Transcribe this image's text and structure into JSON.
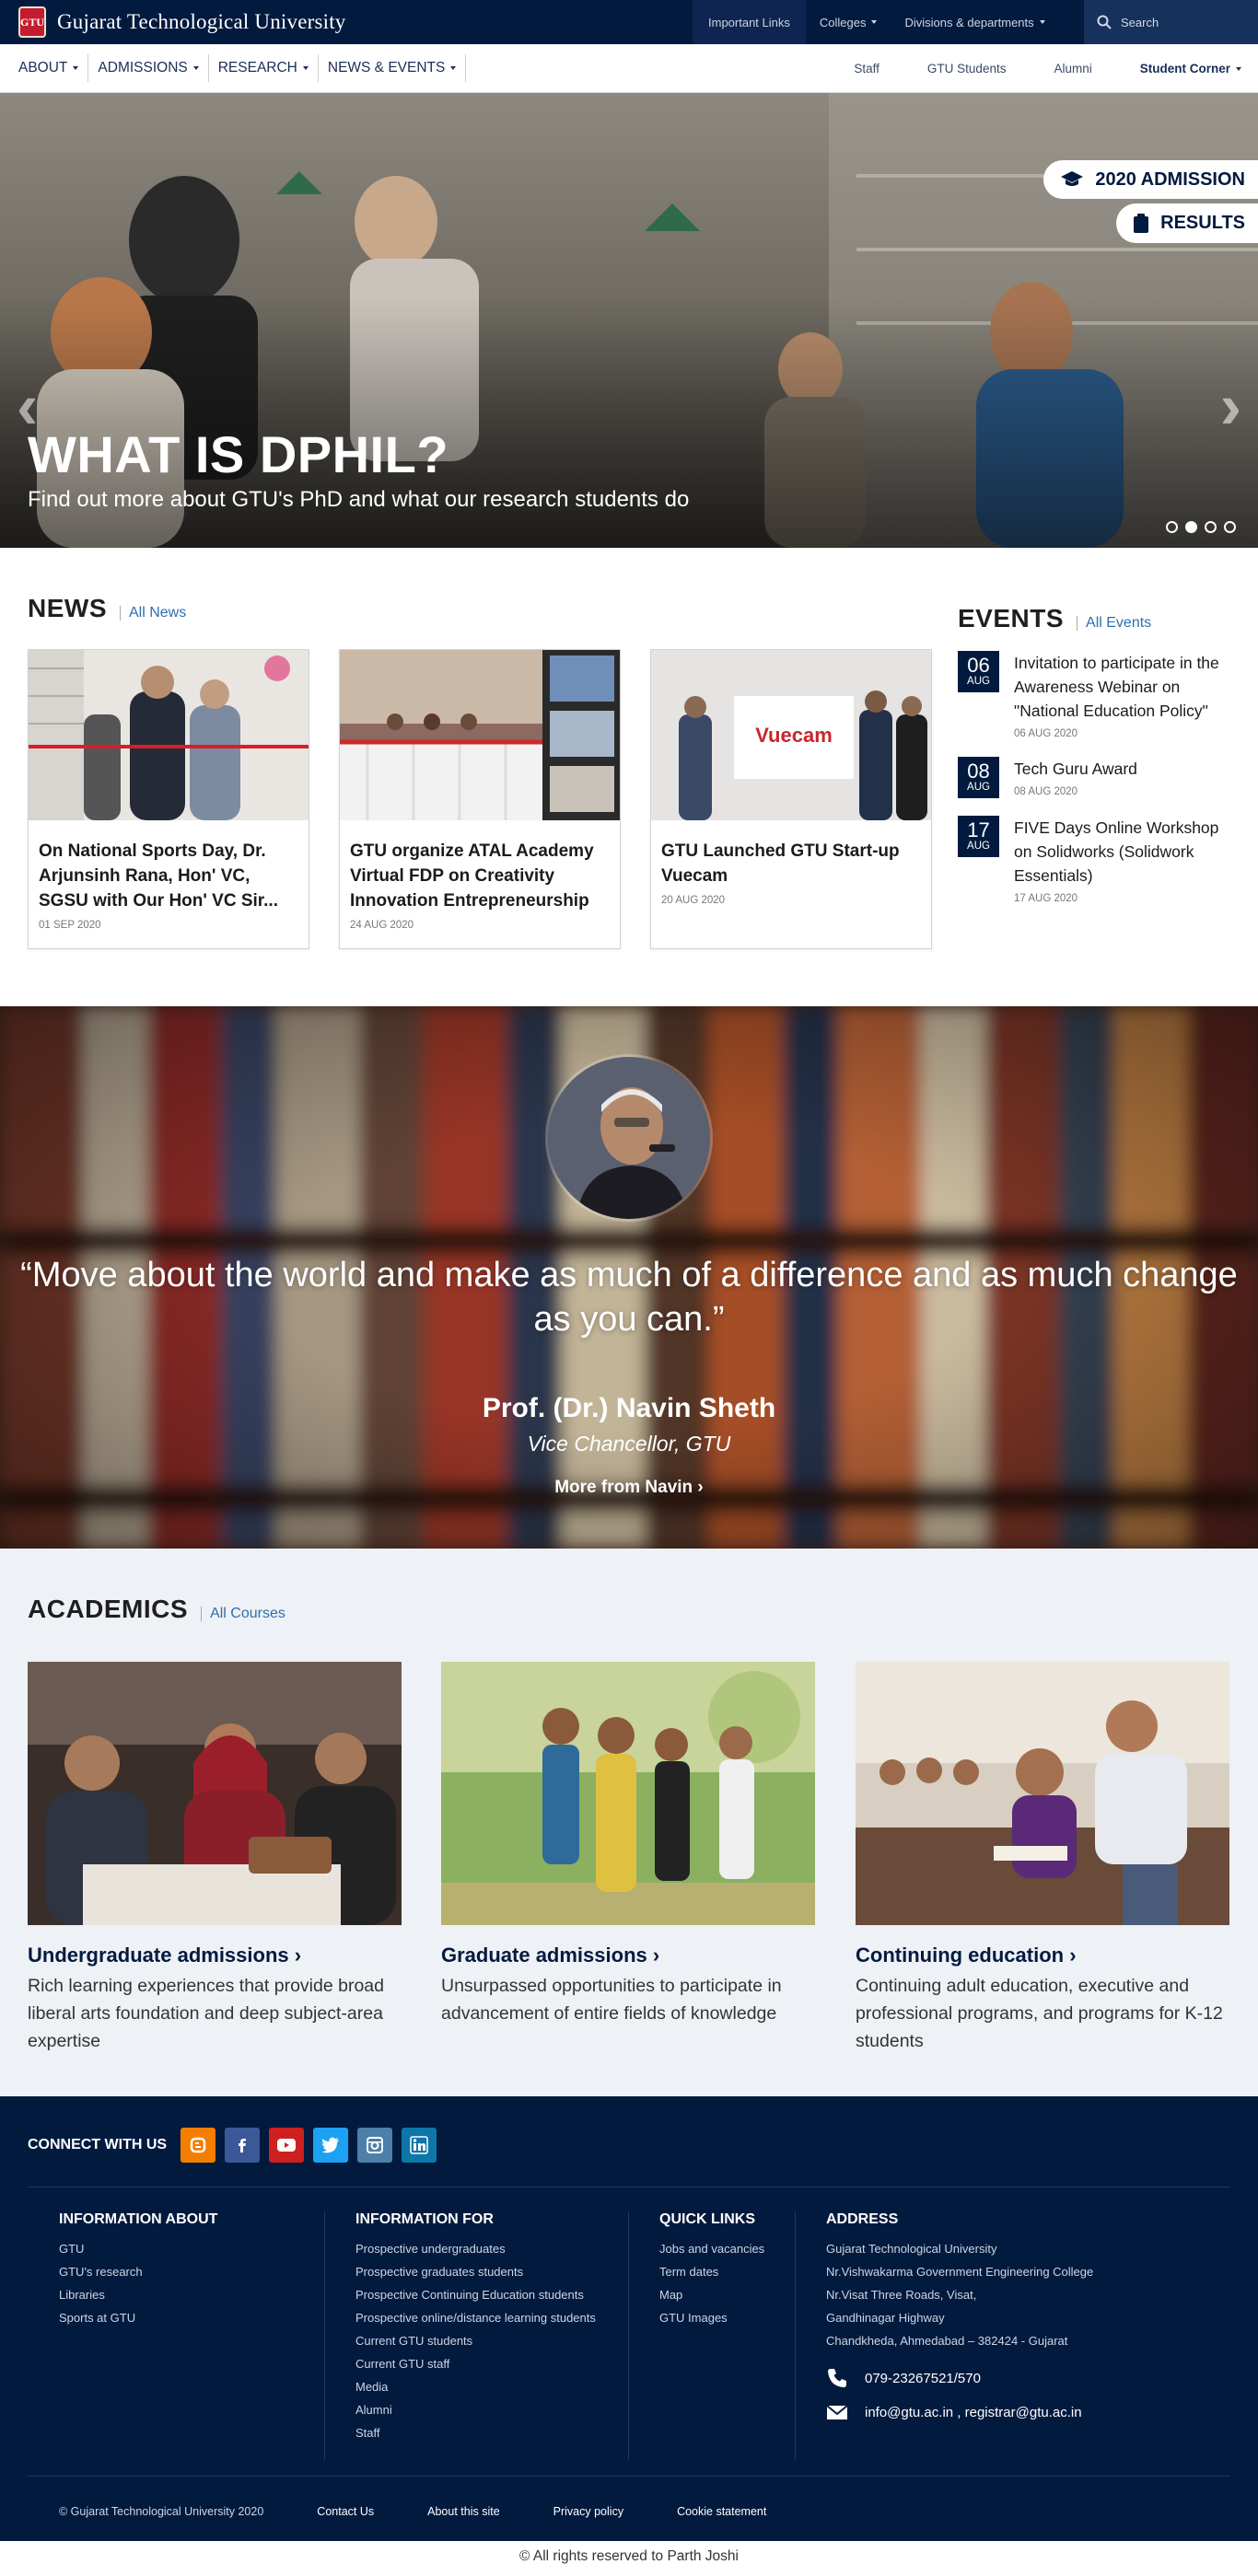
{
  "topbar": {
    "crest_label": "GTU",
    "university": "Gujarat Technological University",
    "links": [
      {
        "label": "Important Links",
        "caret": false
      },
      {
        "label": "Colleges",
        "caret": true
      },
      {
        "label": "Divisions & departments",
        "caret": true
      }
    ],
    "search_placeholder": "Search"
  },
  "main_menu": [
    "ABOUT",
    "ADMISSIONS",
    "RESEARCH",
    "NEWS & EVENTS"
  ],
  "side_links": [
    "Staff",
    "GTU Students",
    "Alumni",
    "Student Corner"
  ],
  "hero": {
    "title": "WHAT IS DPHIL?",
    "subtitle": "Find out more about GTU's PhD and what our research students do",
    "admission_badge": "2020 ADMISSION",
    "results_badge": "RESULTS",
    "active_slide": 2,
    "slide_count": 4
  },
  "news": {
    "heading": "NEWS",
    "link": "All News",
    "items": [
      {
        "title": "On National Sports Day, Dr. Arjunsinh Rana, Hon' VC, SGSU with Our Hon' VC Sir...",
        "date": "01 SEP 2020"
      },
      {
        "title": "GTU organize ATAL Academy Virtual FDP on Creativity Innovation Entrepreneurship",
        "date": "24 AUG 2020"
      },
      {
        "title": "GTU Launched GTU Start-up Vuecam",
        "date": "20 AUG 2020"
      }
    ],
    "vuecam_logo": "Vuecam"
  },
  "events": {
    "heading": "EVENTS",
    "link": "All Events",
    "items": [
      {
        "day": "06",
        "month": "AUG",
        "title": "Invitation to participate in the Awareness Webinar on \"National Education Policy\"",
        "date": "06 AUG 2020"
      },
      {
        "day": "08",
        "month": "AUG",
        "title": "Tech Guru Award",
        "date": "08 AUG 2020"
      },
      {
        "day": "17",
        "month": "AUG",
        "title": "FIVE Days Online Workshop on Solidworks (Solidwork Essentials)",
        "date": "17 AUG 2020"
      }
    ]
  },
  "quote": {
    "text": "“Move about the world and make as much of a difference and as much change as you can.”",
    "name": "Prof. (Dr.) Navin Sheth",
    "role": "Vice Chancellor, GTU",
    "more": "More from Navin ›"
  },
  "academics": {
    "heading": "ACADEMICS",
    "link": "All Courses",
    "items": [
      {
        "title": "Undergraduate admissions",
        "desc": "Rich learning experiences that provide broad liberal arts foundation and deep subject-area expertise"
      },
      {
        "title": "Graduate admissions",
        "desc": "Unsurpassed opportunities to participate in advancement of entire fields of knowledge"
      },
      {
        "title": "Continuing education",
        "desc": "Continuing adult education, executive and professional programs, and programs for K-12 students"
      }
    ]
  },
  "footer": {
    "connect_label": "CONNECT WITH US",
    "social": [
      {
        "icon": "blogger-icon",
        "color": "#f57d00"
      },
      {
        "icon": "facebook-icon",
        "color": "#3b5998"
      },
      {
        "icon": "youtube-icon",
        "color": "#cd201f"
      },
      {
        "icon": "twitter-icon",
        "color": "#1da1f2"
      },
      {
        "icon": "instagram-icon",
        "color": "#4e7fa8"
      },
      {
        "icon": "linkedin-icon",
        "color": "#0e76a8"
      }
    ],
    "info_about": {
      "heading": "INFORMATION ABOUT",
      "links": [
        "GTU",
        "GTU's research",
        "Libraries",
        "Sports at GTU"
      ]
    },
    "info_for": {
      "heading": "INFORMATION FOR",
      "links": [
        "Prospective undergraduates",
        "Prospective graduates students",
        "Prospective Continuing Education students",
        "Prospective online/distance learning students",
        "Current GTU students",
        "Current GTU staff",
        "Media",
        "Alumni",
        "Staff"
      ]
    },
    "quick_links": {
      "heading": "QUICK LINKS",
      "links": [
        "Jobs and vacancies",
        "Term dates",
        "Map",
        "GTU Images"
      ]
    },
    "address": {
      "heading": "ADDRESS",
      "lines": [
        "Gujarat Technological University",
        "Nr.Vishwakarma Government Engineering College",
        "Nr.Visat Three Roads, Visat,",
        "Gandhinagar Highway",
        "Chandkheda, Ahmedabad – 382424 - Gujarat"
      ],
      "phone": "079-23267521/570",
      "email": "info@gtu.ac.in , registrar@gtu.ac.in"
    },
    "copyright": "© Gujarat Technological University 2020",
    "bottom_links": [
      "Contact Us",
      "About this site",
      "Privacy policy",
      "Cookie statement"
    ]
  },
  "credits": "© All rights reserved to Parth Joshi"
}
